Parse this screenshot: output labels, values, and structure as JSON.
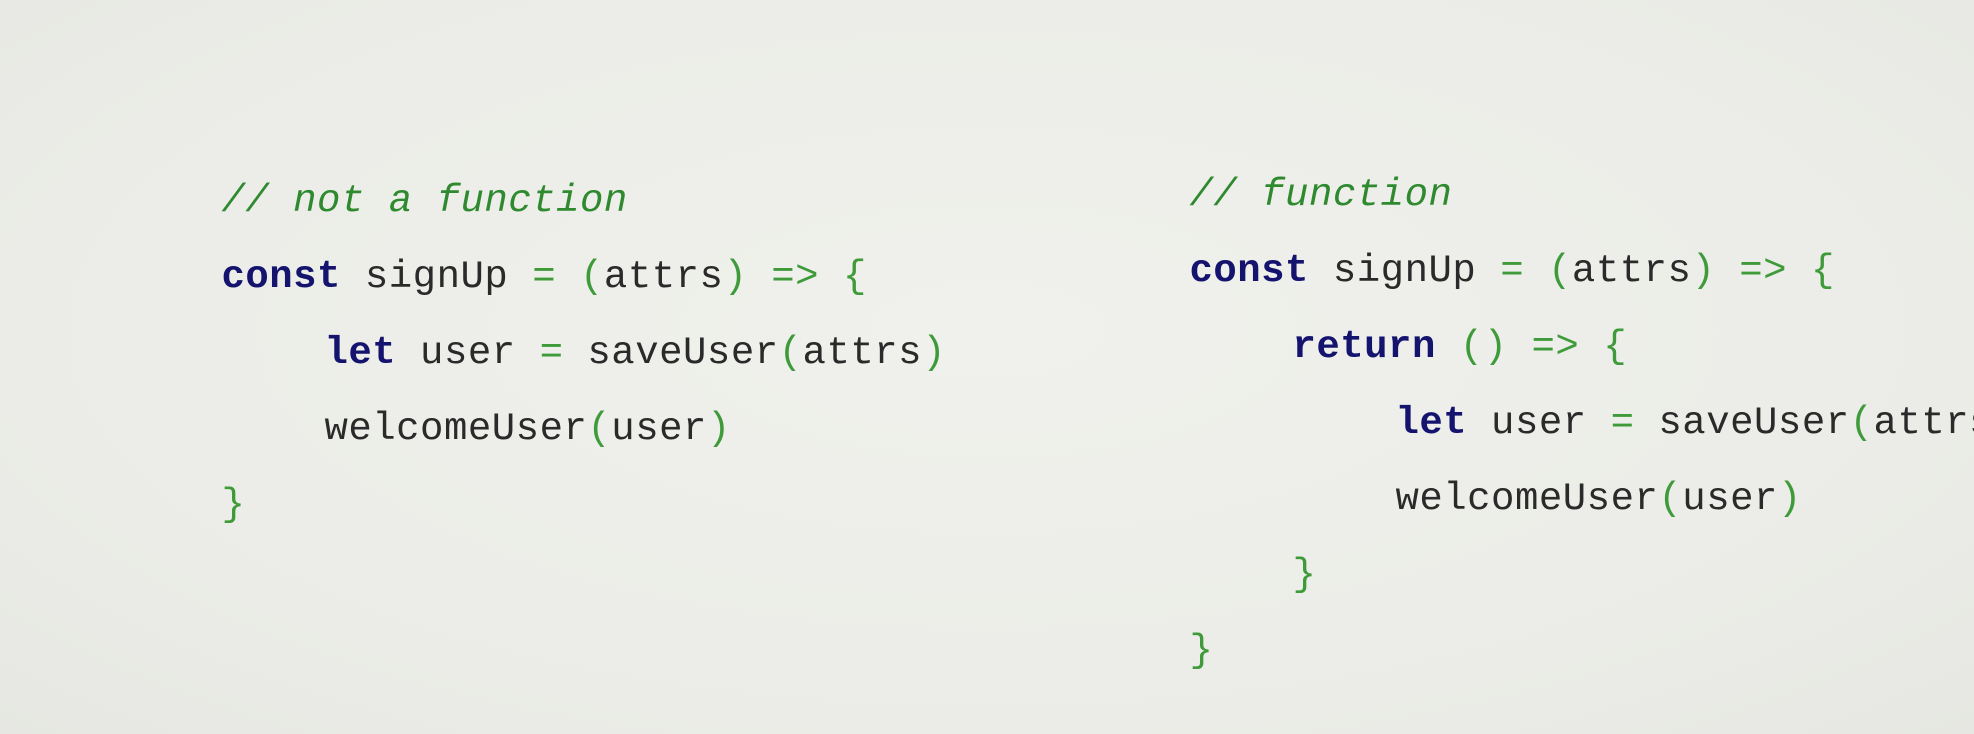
{
  "colors": {
    "background": "#ecede8",
    "comment": "#2f8a2f",
    "keyword": "#14146e",
    "punctuation": "#3f9a3a",
    "identifier": "#2a2a2a"
  },
  "left": {
    "comment": "// not a function",
    "line1": {
      "kw": "const",
      "name": " signUp ",
      "eq": "=",
      "open_paren": " (",
      "param": "attrs",
      "close_paren": ")",
      "arrow": " =>",
      "brace": " {"
    },
    "line2": {
      "kw": "let",
      "name": " user ",
      "eq": "=",
      "call": " saveUser",
      "open_paren": "(",
      "arg": "attrs",
      "close_paren": ")"
    },
    "line3": {
      "call": "welcomeUser",
      "open_paren": "(",
      "arg": "user",
      "close_paren": ")"
    },
    "close_brace": "}"
  },
  "right": {
    "comment": "// function",
    "line1": {
      "kw": "const",
      "name": " signUp ",
      "eq": "=",
      "open_paren": " (",
      "param": "attrs",
      "close_paren": ")",
      "arrow": " =>",
      "brace": " {"
    },
    "line2": {
      "kw": "return",
      "parens": " ()",
      "arrow": " =>",
      "brace": " {"
    },
    "line3": {
      "kw": "let",
      "name": " user ",
      "eq": "=",
      "call": " saveUser",
      "open_paren": "(",
      "arg": "attrs",
      "close_paren": ")"
    },
    "line4": {
      "call": "welcomeUser",
      "open_paren": "(",
      "arg": "user",
      "close_paren": ")"
    },
    "inner_close_brace": "}",
    "close_brace": "}"
  }
}
